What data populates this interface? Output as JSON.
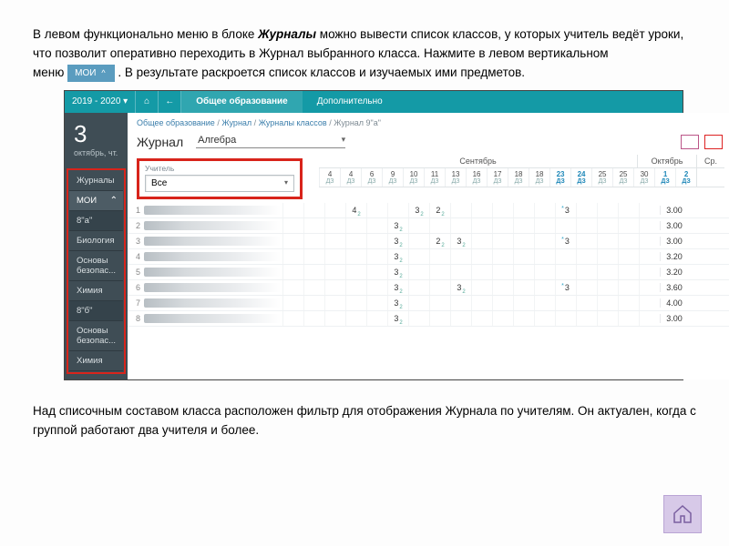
{
  "doc": {
    "p1_a": "В левом функционально меню в блоке ",
    "p1_bold": "Журналы",
    "p1_b": " можно вывести список классов, у которых учитель ведёт уроки, что позволит оперативно переходить в Журнал выбранного класса. Нажмите  в левом вертикальном",
    "p2_a": "меню ",
    "p2_b": ". В результате раскроется список классов и изучаемых ими предметов.",
    "moi_btn": "МОИ",
    "p3": "Над списочным составом класса расположен фильтр для отображения Журнала по учителям. Он актуален, когда с группой работают два учителя и более."
  },
  "app": {
    "year": "2019 - 2020",
    "tab_main": "Общее образование",
    "tab_extra": "Дополнительно",
    "date_num": "3",
    "date_label": "октябрь, чт.",
    "sidebar": {
      "journals": "Журналы",
      "moi": "МОИ",
      "cls_a": "8\"а\"",
      "sub_bio": "Биология",
      "sub_obg": "Основы безопас...",
      "sub_chem": "Химия",
      "cls_b": "8\"б\"",
      "sub_obg2": "Основы безопас...",
      "sub_chem2": "Химия"
    },
    "crumbs": {
      "a": "Общее образование",
      "b": "Журнал",
      "c": "Журналы классов",
      "d": "Журнал 9\"а\""
    },
    "title": "Журнал",
    "subject": "Алгебра",
    "filter_label": "Учитель",
    "filter_value": "Все",
    "month1": "Сентябрь",
    "month2": "Октябрь",
    "avg_hdr": "Ср.",
    "days": [
      "4",
      "4",
      "6",
      "9",
      "10",
      "11",
      "13",
      "16",
      "17",
      "18",
      "18",
      "23",
      "24",
      "25",
      "25",
      "30",
      "1",
      "2"
    ],
    "day_blue_idx": [
      11,
      12,
      16,
      17
    ],
    "dz": "ДЗ",
    "rows": [
      {
        "n": "1",
        "marks": {
          "3": "4",
          "6": "3",
          "7": "2"
        },
        "star": [
          13
        ],
        "avg": "3.00"
      },
      {
        "n": "2",
        "marks": {
          "5": "3"
        },
        "avg": "3.00"
      },
      {
        "n": "3",
        "marks": {
          "5": "3",
          "7": "2",
          "8": "3"
        },
        "star": [
          13
        ],
        "avg": "3.00"
      },
      {
        "n": "4",
        "marks": {
          "5": "3"
        },
        "avg": "3.20"
      },
      {
        "n": "5",
        "marks": {
          "5": "3"
        },
        "avg": "3.20"
      },
      {
        "n": "6",
        "marks": {
          "5": "3",
          "8": "3"
        },
        "star": [
          13
        ],
        "avg": "3.60"
      },
      {
        "n": "7",
        "marks": {
          "5": "3"
        },
        "avg": "4.00"
      },
      {
        "n": "8",
        "marks": {
          "5": "3"
        },
        "avg": "3.00"
      }
    ]
  }
}
